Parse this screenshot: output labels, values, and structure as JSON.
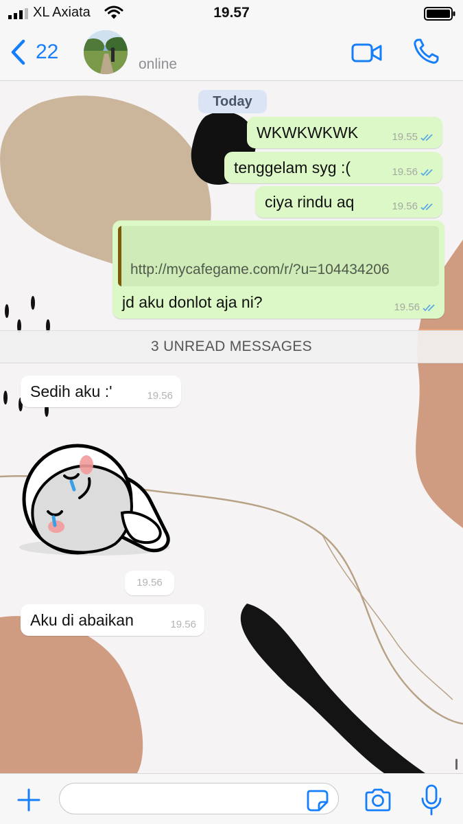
{
  "status_bar": {
    "carrier": "XL Axiata",
    "time": "19.57"
  },
  "header": {
    "back_count": "22",
    "contact_status": "online"
  },
  "chat": {
    "date_label": "Today",
    "outgoing": [
      {
        "text": "WKWKWKWK",
        "time": "19.55",
        "status": "read"
      },
      {
        "text": "tenggelam syg :(",
        "time": "19.56",
        "status": "read"
      },
      {
        "text": "ciya rindu aq",
        "time": "19.56",
        "status": "read"
      },
      {
        "link_url": "http://mycafegame.com/r/?u=104434206",
        "text": "jd aku donlot aja ni?",
        "time": "19.56",
        "status": "read"
      }
    ],
    "unread_label": "3 UNREAD MESSAGES",
    "incoming": [
      {
        "text": "Sedih aku :'",
        "time": "19.56"
      },
      {
        "type": "sticker",
        "time": "19.56"
      },
      {
        "text": "Aku di abaikan",
        "time": "19.56"
      }
    ]
  },
  "input_bar": {
    "placeholder": "",
    "icons": [
      "plus-icon",
      "sticker-icon",
      "camera-icon",
      "microphone-icon"
    ]
  },
  "colors": {
    "accent": "#147efb",
    "outgoing_bubble": "#dcf8c6",
    "incoming_bubble": "#ffffff",
    "read_ticks": "#4fa3e8"
  }
}
